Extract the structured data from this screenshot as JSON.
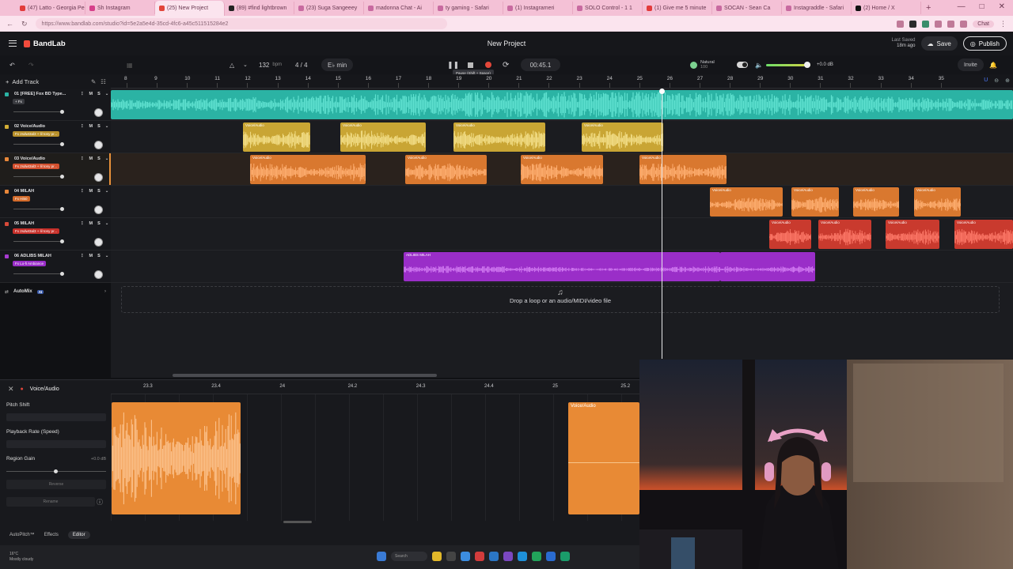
{
  "browser": {
    "tabs": [
      {
        "label": "(47) Latto - Georgia Pe",
        "color": "#e23b3b"
      },
      {
        "label": "Sh Instagram",
        "color": "#d63f8a"
      },
      {
        "label": "(25) New Project",
        "color": "#e2453a",
        "active": true
      },
      {
        "label": "(89) #find lightbrown",
        "color": "#222222"
      },
      {
        "label": "(23) Suga Sangeeey",
        "color": "#c86aa0"
      },
      {
        "label": "madonna Chat - Ai",
        "color": "#c86aa0"
      },
      {
        "label": "ty gaming - Safari",
        "color": "#c86aa0"
      },
      {
        "label": "(1) Instagrameri",
        "color": "#c86aa0"
      },
      {
        "label": "SOLO Control - 1 1",
        "color": "#c86aa0"
      },
      {
        "label": "(1) Give me 5 minute",
        "color": "#e23b3b"
      },
      {
        "label": "SOCAN - Sean Ca",
        "color": "#c86aa0"
      },
      {
        "label": "Instagraddle - Safari",
        "color": "#c86aa0"
      },
      {
        "label": "(2) Home / X",
        "color": "#111111"
      }
    ],
    "url": "https://www.bandlab.com/studio?id=5e2a5e4d-35cd-4fc6-a45c511515284e2",
    "chat_label": "Chat"
  },
  "app": {
    "logo_text": "BandLab",
    "project_title": "New Project",
    "last_saved_label": "Last Saved",
    "last_saved_value": "18m ago",
    "save_label": "Save",
    "publish_label": "Publish",
    "invite_label": "Invite"
  },
  "transport": {
    "bpm_value": "132",
    "bpm_unit": "bpm",
    "time_signature": "4 / 4",
    "key": "E♭ min",
    "time": "00:45.1",
    "tooltip": "Pause (Shift + Space)",
    "mix_preset": "Natural",
    "mix_preset_sub": "100",
    "master_gain": "+0.0 dB"
  },
  "ruler": {
    "add_track_label": "Add Track",
    "bars": [
      "8",
      "9",
      "10",
      "11",
      "12",
      "13",
      "14",
      "15",
      "16",
      "17",
      "18",
      "19",
      "20",
      "21",
      "22",
      "23",
      "24",
      "25",
      "26",
      "27",
      "28",
      "29",
      "30",
      "31",
      "32",
      "33",
      "34",
      "35"
    ]
  },
  "tracks": [
    {
      "name": "01 [FREE] Fox BD Type...",
      "fx": "+ Fx",
      "color": "#2bb3a4",
      "fx_color": "#3a3b40"
    },
    {
      "name": "02 Voice/Audio",
      "fx": "Fx 2sdwt3al3 + lil tony pr...",
      "color": "#d2ad35",
      "fx_color": "#b8902a"
    },
    {
      "name": "03 Voice/Audio",
      "fx": "Fx 2sdwt3al3 + lil tony pr...",
      "color": "#e8873a",
      "fx_color": "#d4502e"
    },
    {
      "name": "04 MILAH",
      "fx": "Fx Hi50",
      "color": "#e8873a",
      "fx_color": "#d26a2a"
    },
    {
      "name": "05 MILAH",
      "fx": "Fx 2sdwt3al3 + lil tony pr...",
      "color": "#d84a3a",
      "fx_color": "#c7302a"
    },
    {
      "name": "06 ADLIBS MILAH",
      "fx": "Fx Lo-fi Ambiance",
      "color": "#a83bd0",
      "fx_color": "#9a2ec8"
    }
  ],
  "clip_labels": {
    "voice": "Voice/Audio",
    "milah": "Voice/Audio",
    "adlibs": "ADLIBS MILAH"
  },
  "automix": {
    "label": "AutoMix",
    "badge": "AI"
  },
  "drop_zone": {
    "text": "Drop a loop or an audio/MIDI/video file"
  },
  "editor": {
    "title": "Voice/Audio",
    "pitch_shift_label": "Pitch Shift",
    "playback_rate_label": "Playback Rate (Speed)",
    "region_gain_label": "Region Gain",
    "region_gain_value": "+0.0 dB",
    "reverse_label": "Reverse",
    "rename_label": "Rename",
    "ticks": [
      "23.3",
      "23.4",
      "24",
      "24.2",
      "24.3",
      "24.4",
      "25",
      "25.2"
    ],
    "clip_label": "Voice/Audio",
    "tabs": [
      "AutoPitch™",
      "Effects",
      "Editor"
    ]
  },
  "taskbar": {
    "weather_temp": "16°C",
    "weather_text": "Mostly cloudy",
    "search_placeholder": "Search"
  }
}
